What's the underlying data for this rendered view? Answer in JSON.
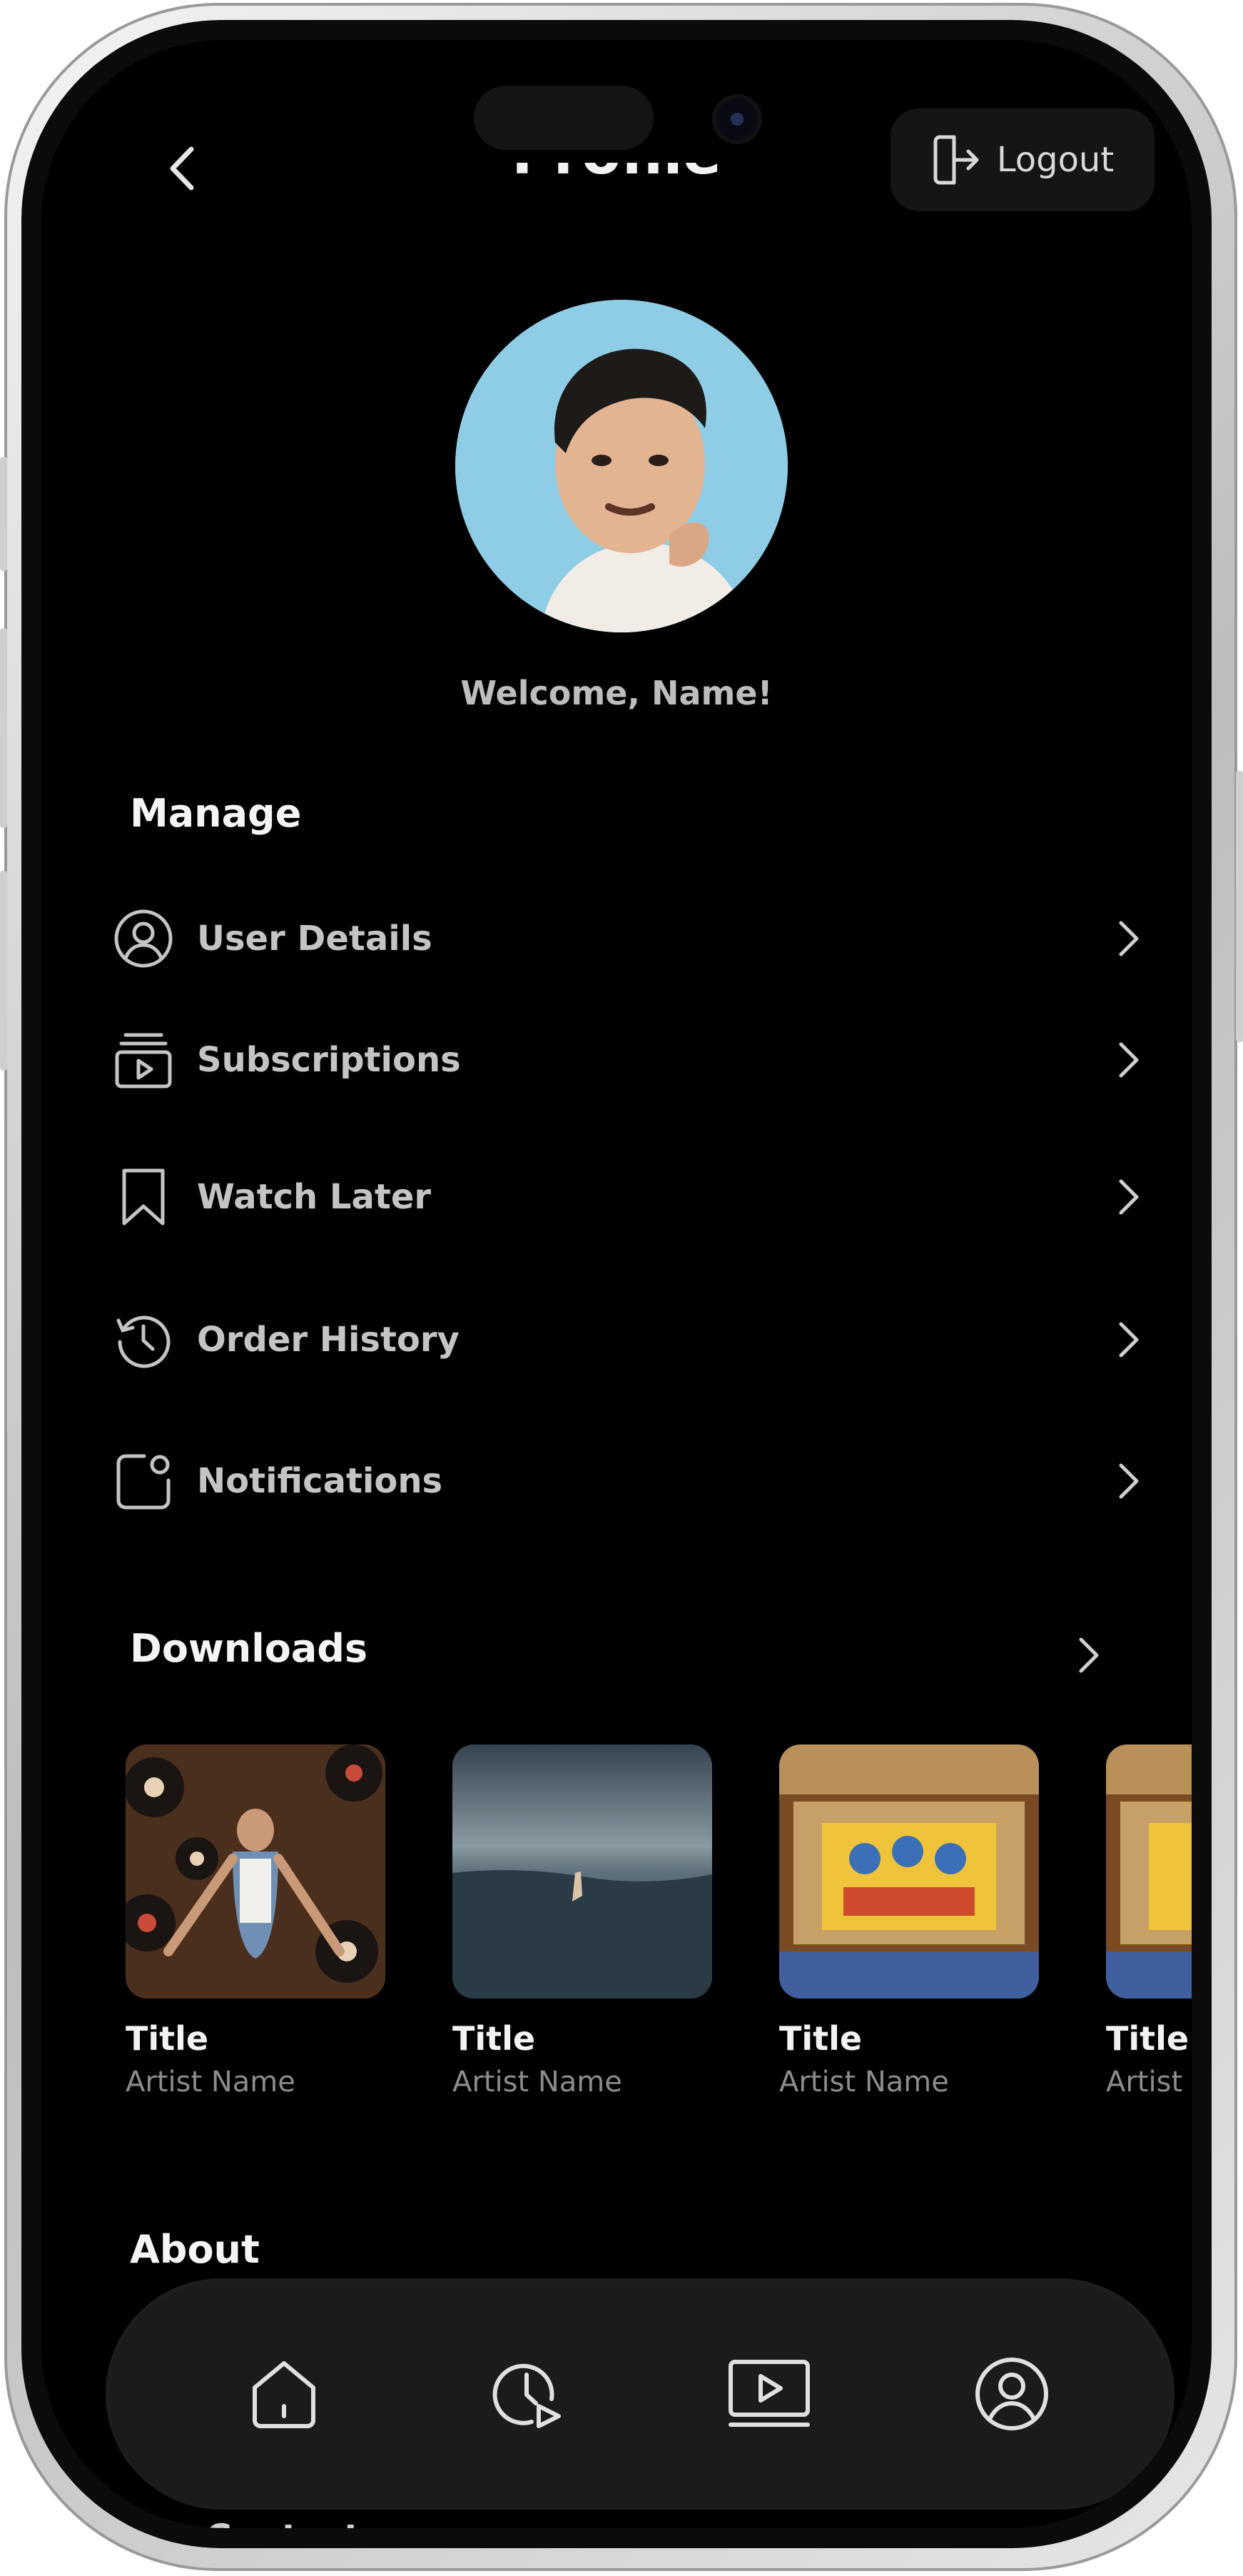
{
  "header": {
    "title": "Profile",
    "back_icon": "chevron-left-icon",
    "logout_label": "Logout",
    "logout_icon": "logout-icon"
  },
  "profile": {
    "welcome_text": "Welcome, Name!",
    "avatar_bg": "#8fcde6"
  },
  "manage": {
    "heading": "Manage",
    "items": [
      {
        "label": "User Details",
        "icon": "user-circle-icon"
      },
      {
        "label": "Subscriptions",
        "icon": "subscriptions-icon"
      },
      {
        "label": "Watch Later",
        "icon": "bookmark-icon"
      },
      {
        "label": "Order History",
        "icon": "history-icon"
      },
      {
        "label": "Notifications",
        "icon": "notification-icon"
      }
    ]
  },
  "downloads": {
    "heading": "Downloads",
    "items": [
      {
        "title": "Title",
        "artist": "Artist Name"
      },
      {
        "title": "Title",
        "artist": "Artist Name"
      },
      {
        "title": "Title",
        "artist": "Artist Name"
      },
      {
        "title": "Title",
        "artist": "Artist Name"
      }
    ]
  },
  "about": {
    "heading": "About",
    "contact_label": "Contact us"
  },
  "bottom_nav": {
    "items": [
      {
        "icon": "home-icon"
      },
      {
        "icon": "history-play-icon"
      },
      {
        "icon": "video-library-icon"
      },
      {
        "icon": "profile-icon"
      }
    ]
  },
  "colors": {
    "background": "#000000",
    "text_primary": "#f2f2f2",
    "text_secondary": "#c4c4c4",
    "nav_bg": "#1b1b1b"
  }
}
